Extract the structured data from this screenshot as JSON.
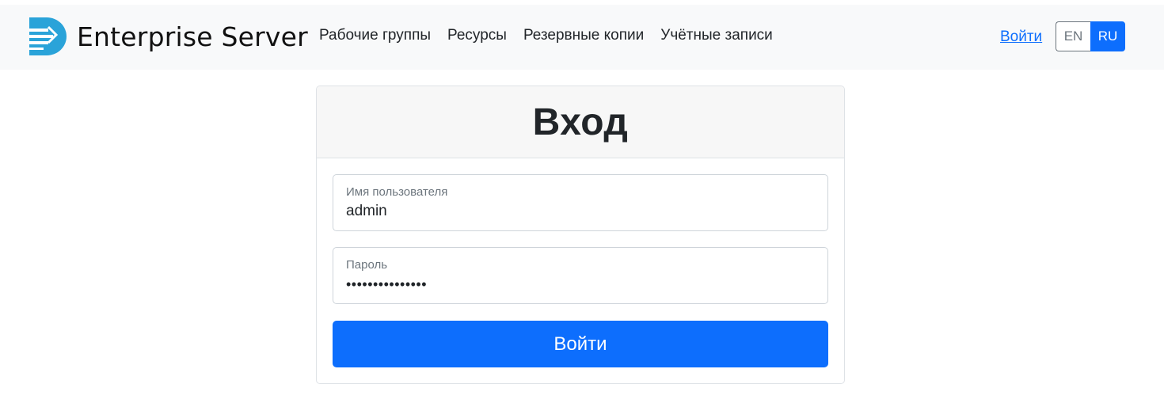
{
  "header": {
    "brand_name": "Enterprise Server",
    "logo_icon": "d-logo-icon",
    "nav": [
      {
        "label": "Рабочие группы"
      },
      {
        "label": "Ресурсы"
      },
      {
        "label": "Резервные копии"
      },
      {
        "label": "Учётные записи"
      }
    ],
    "login_link": "Войти",
    "languages": [
      {
        "label": "EN",
        "active": false
      },
      {
        "label": "RU",
        "active": true
      }
    ]
  },
  "login_form": {
    "title": "Вход",
    "username": {
      "label": "Имя пользователя",
      "value": "admin"
    },
    "password": {
      "label": "Пароль",
      "value": "•••••••••••••••"
    },
    "submit_label": "Войти"
  },
  "colors": {
    "primary": "#0d6efd",
    "logo_blue": "#2aa3d9",
    "navbar_bg": "#f8f9fa",
    "card_header_bg": "#f7f7f7"
  }
}
